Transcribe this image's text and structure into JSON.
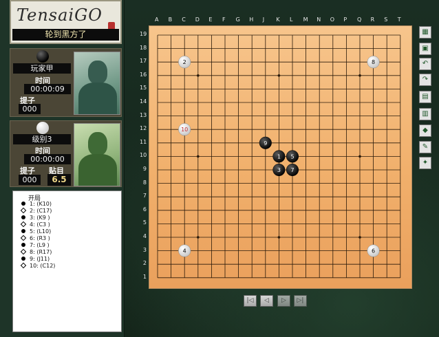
{
  "app": {
    "logo": "TensaiGO"
  },
  "status": "轮到黑方了",
  "black_player": {
    "name": "玩家甲",
    "time_label": "时间",
    "time": "00:00:09",
    "captures_label": "提子",
    "captures": "000"
  },
  "white_player": {
    "name": "级别3",
    "time_label": "时间",
    "time": "00:00:00",
    "captures_label": "提子",
    "captures": "000",
    "komi_label": "贴目",
    "komi": "6.5"
  },
  "move_list": {
    "header": "开局",
    "moves": [
      {
        "color": "black",
        "text": "1:  (K10)"
      },
      {
        "color": "white",
        "text": "2:  (C17)"
      },
      {
        "color": "black",
        "text": "3:  (K9 )"
      },
      {
        "color": "white",
        "text": "4:  (C3 )"
      },
      {
        "color": "black",
        "text": "5:  (L10)"
      },
      {
        "color": "white",
        "text": "6:  (R3 )"
      },
      {
        "color": "black",
        "text": "7:  (L9 )"
      },
      {
        "color": "white",
        "text": "8:  (R17)"
      },
      {
        "color": "black",
        "text": "9:  (J11)"
      },
      {
        "color": "white",
        "text": "10: (C12)"
      }
    ]
  },
  "board": {
    "size": 19,
    "columns": [
      "A",
      "B",
      "C",
      "D",
      "E",
      "F",
      "G",
      "H",
      "J",
      "K",
      "L",
      "M",
      "N",
      "O",
      "P",
      "Q",
      "R",
      "S",
      "T"
    ],
    "rows": [
      "19",
      "18",
      "17",
      "16",
      "15",
      "14",
      "13",
      "12",
      "11",
      "10",
      "9",
      "8",
      "7",
      "6",
      "5",
      "4",
      "3",
      "2",
      "1"
    ],
    "stones": [
      {
        "n": "1",
        "color": "black",
        "col": 9,
        "row": 10
      },
      {
        "n": "2",
        "color": "white",
        "col": 2,
        "row": 17
      },
      {
        "n": "3",
        "color": "black",
        "col": 9,
        "row": 9
      },
      {
        "n": "4",
        "color": "white",
        "col": 2,
        "row": 3
      },
      {
        "n": "5",
        "color": "black",
        "col": 10,
        "row": 10
      },
      {
        "n": "6",
        "color": "white",
        "col": 16,
        "row": 3
      },
      {
        "n": "7",
        "color": "black",
        "col": 10,
        "row": 9
      },
      {
        "n": "8",
        "color": "white",
        "col": 16,
        "row": 17
      },
      {
        "n": "9",
        "color": "black",
        "col": 8,
        "row": 11
      },
      {
        "n": "10",
        "color": "white",
        "col": 2,
        "row": 12,
        "last": true
      }
    ],
    "line_color": "#2a1a0a",
    "last_move_color": "#c0282c"
  },
  "nav": [
    "first-icon",
    "prev-icon",
    "next-icon",
    "last-icon"
  ],
  "toolbar": [
    "new-game-icon",
    "save-icon",
    "undo-icon",
    "pass-icon",
    "resign-icon",
    "score-icon",
    "hint-icon",
    "chat-icon",
    "settings-icon"
  ]
}
